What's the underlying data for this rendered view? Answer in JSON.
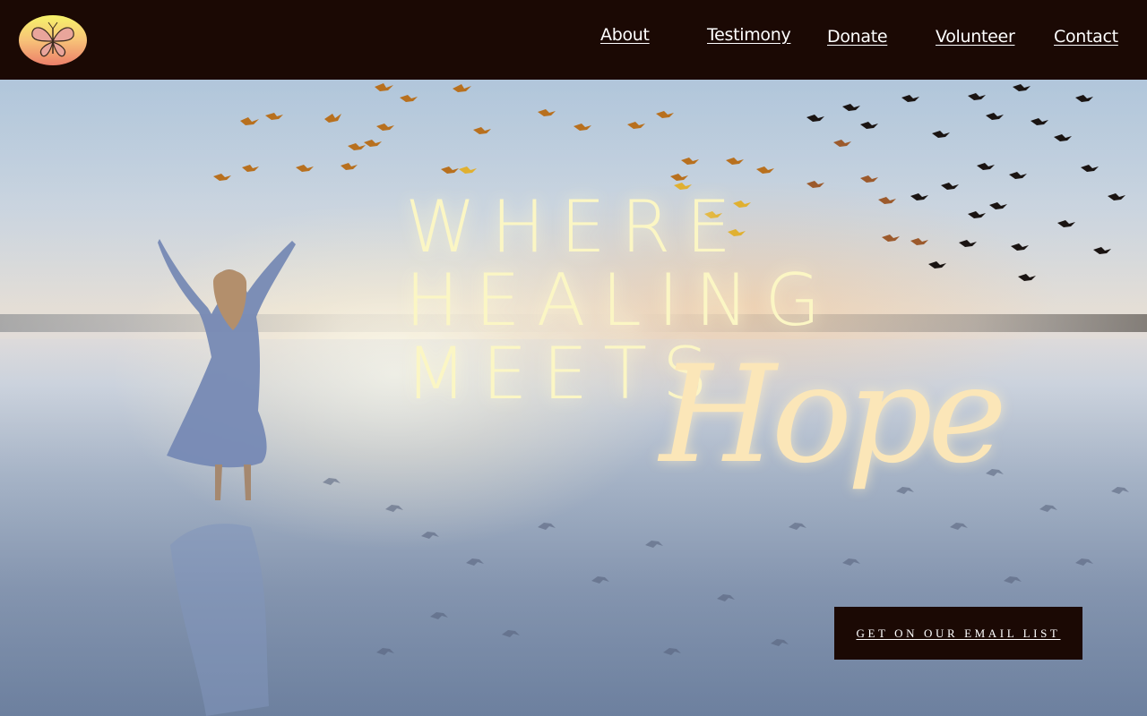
{
  "nav": {
    "about": "About",
    "testimony": "Testimony",
    "donate": "Donate",
    "volunteer": "Volunteer",
    "contact": "Contact"
  },
  "hero": {
    "line1": "WHERE",
    "line2": "HEALING",
    "line3": "MEETS",
    "script": "Hope"
  },
  "cta": {
    "label": "GET ON OUR EMAIL LIST"
  },
  "icons": {
    "logo": "butterfly-logo-icon"
  },
  "colors": {
    "header_bg": "#1b0904",
    "headline": "#fbf6c4",
    "script": "#fbe6b8"
  }
}
